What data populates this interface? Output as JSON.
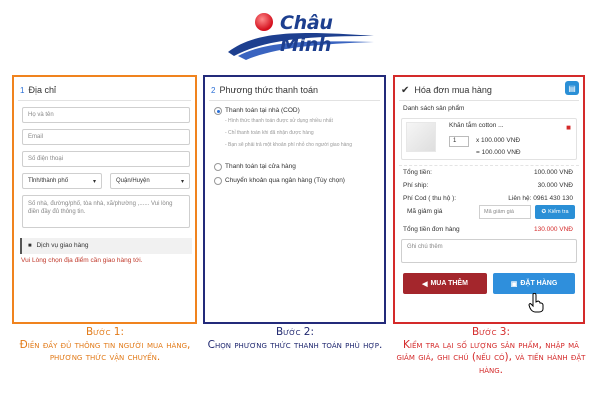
{
  "brand": {
    "name": "Châu Minh"
  },
  "panel1": {
    "number": "1",
    "title": "Địa chỉ",
    "fields": {
      "name_placeholder": "Họ và tên",
      "email_placeholder": "Email",
      "phone_placeholder": "Số điện thoại",
      "province_select": "Tỉnh/thành phố",
      "district_select": "Quận/Huyện",
      "address_placeholder": "Số nhà, đường/phố, tòa nhà, xã/phường ,...... Vui lòng điền đầy đủ thông tin."
    },
    "shipping_label": "Dịch vụ giao hàng",
    "shipping_warning": "Vui Lòng chọn địa điểm cần giao hàng tới."
  },
  "panel2": {
    "number": "2",
    "title": "Phương thức thanh toán",
    "options": [
      {
        "label": "Thanh toán tại nhà (COD)",
        "selected": true,
        "notes": [
          "- Hình thức thanh toán được sử dụng nhiều nhất",
          "- Chỉ thanh toán khi đã nhận được hàng",
          "- Bạn sẽ phải trả một khoản phí nhỏ cho người giao hàng"
        ]
      },
      {
        "label": "Thanh toán tại cửa hàng",
        "selected": false,
        "notes": []
      },
      {
        "label": "Chuyển khoản qua ngân hàng (Tùy chọn)",
        "selected": false,
        "notes": []
      }
    ]
  },
  "panel3": {
    "title": "Hóa đơn mua hàng",
    "product_list_label": "Danh sách sản phẩm",
    "product": {
      "name": "Khăn tắm cotton ...",
      "quantity": "1",
      "unit_price": "x 100.000 VNĐ",
      "line_total": "= 100.000 VNĐ"
    },
    "summary": {
      "subtotal_label": "Tổng tiền:",
      "subtotal_value": "100.000 VNĐ",
      "shipping_label": "Phí ship:",
      "shipping_value": "30.000 VNĐ",
      "cod_label": "Phí Cod ( thu hộ ):",
      "cod_value": "Liên hệ: 0961 430 130",
      "coupon_label": "Mã giảm giá",
      "coupon_placeholder": "Mã giảm giá",
      "coupon_button": "Kiểm tra",
      "total_label": "Tổng tiền đơn hàng",
      "total_value": "130.000 VNĐ"
    },
    "notes_placeholder": "Ghi chú thêm",
    "back_button": "MUA THÊM",
    "order_button": "ĐẶT HÀNG"
  },
  "captions": {
    "step1_title": "Bước 1:",
    "step1_text": "Điền đầy đủ thông tin người mua hàng, phương thức vận chuyển.",
    "step2_title": "Bước 2:",
    "step2_text": "Chọn phương thức thanh toán phù hợp.",
    "step3_title": "Bước 3:",
    "step3_text": "Kiểm tra lại số lượng sản phẩm, nhập mã giảm giá, ghi chú (nếu có), và tiến hành đặt hàng."
  },
  "colors": {
    "step1": "#f0831e",
    "step2": "#232a7a",
    "step3": "#d42a2a",
    "primary_button": "#2f8fdc",
    "back_button": "#a4262c"
  }
}
